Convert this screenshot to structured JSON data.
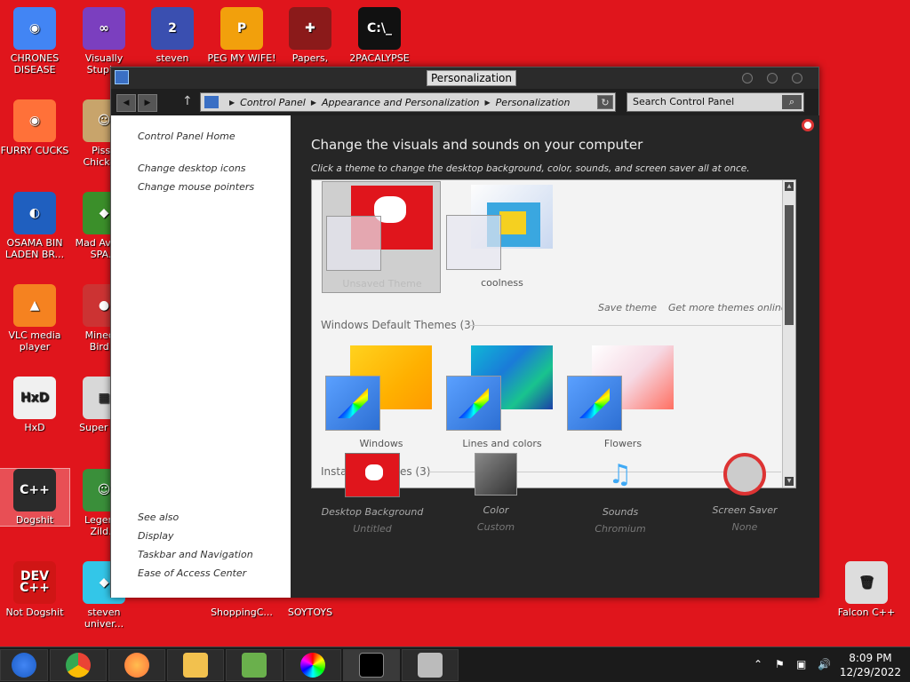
{
  "desktop": {
    "icons": [
      {
        "label": "CHRONES DISEASE",
        "glyph": "◉",
        "color": "#4285f4",
        "icon": "chrome-icon"
      },
      {
        "label": "Visually Stupi...",
        "glyph": "∞",
        "color": "#7b3fbf",
        "icon": "visual-studio-icon"
      },
      {
        "label": "steven",
        "glyph": "2",
        "color": "#3a4fb0",
        "icon": "app-icon"
      },
      {
        "label": "PEG MY WIFE!",
        "glyph": "P",
        "color": "#f2a00c",
        "icon": "app-icon"
      },
      {
        "label": "Papers,",
        "glyph": "✚",
        "color": "#8b1a1a",
        "icon": "app-icon"
      },
      {
        "label": "2PACALYPSE",
        "glyph": "C:\\_",
        "color": "#111111",
        "icon": "cmd-icon"
      },
      {
        "label": "FURRY CUCKS",
        "glyph": "◉",
        "color": "#ff7139",
        "icon": "firefox-icon"
      },
      {
        "label": "Pisse Chicke...",
        "glyph": "☺",
        "color": "#c8a46b",
        "icon": "app-icon"
      },
      {
        "label": "OSAMA BIN LADEN BR...",
        "glyph": "◐",
        "color": "#1f5fbf",
        "icon": "app-icon"
      },
      {
        "label": "Mad Av... IN SPA...",
        "glyph": "◆",
        "color": "#3b8f2a",
        "icon": "app-icon"
      },
      {
        "label": "VLC media player",
        "glyph": "▲",
        "color": "#f58220",
        "icon": "vlc-icon"
      },
      {
        "label": "Minec... Bird...",
        "glyph": "●",
        "color": "#cc3333",
        "icon": "app-icon"
      },
      {
        "label": "HxD",
        "glyph": "HxD",
        "color": "#f0f0f0",
        "icon": "hxd-icon"
      },
      {
        "label": "Super M...",
        "glyph": "▦",
        "color": "#d8d8d8",
        "icon": "app-icon"
      },
      {
        "label": "Dogshit",
        "glyph": "C++",
        "color": "#2b2b2b",
        "icon": "app-icon"
      },
      {
        "label": "Legen... Zild...",
        "glyph": "☺",
        "color": "#3a8f3a",
        "icon": "app-icon"
      },
      {
        "label": "Not Dogshit",
        "glyph": "DEV C++",
        "color": "#d01515",
        "icon": "devcpp-icon"
      },
      {
        "label": "steven univer...",
        "glyph": "◆",
        "color": "#33c6e8",
        "icon": "app-icon"
      },
      {
        "label": "ShoppingC...",
        "glyph": "",
        "color": "#e0151c",
        "icon": "app-icon"
      },
      {
        "label": "SOYTOYS",
        "glyph": "",
        "color": "#e0151c",
        "icon": "app-icon"
      },
      {
        "label": "Falcon C++",
        "glyph": "🗑",
        "color": "#dddddd",
        "icon": "recycle-bin-icon"
      }
    ]
  },
  "window": {
    "title": "Personalization",
    "address": {
      "crumbs": [
        "Control Panel",
        "Appearance and Personalization",
        "Personalization"
      ]
    },
    "search_placeholder": "Search Control Panel",
    "left": {
      "links": [
        "Control Panel Home",
        "Change desktop icons",
        "Change mouse pointers"
      ],
      "see_also_title": "See also",
      "see_also": [
        "Display",
        "Taskbar and Navigation",
        "Ease of Access Center"
      ]
    },
    "heading": "Change the visuals and sounds on your computer",
    "subheading": "Click a theme to change the desktop background, color, sounds, and screen saver all at once.",
    "my_themes": [
      {
        "name": "Unsaved Theme"
      },
      {
        "name": "coolness"
      }
    ],
    "save_theme": "Save theme",
    "get_more": "Get more themes online",
    "default_section": "Windows Default Themes (3)",
    "default_themes": [
      {
        "name": "Windows"
      },
      {
        "name": "Lines and colors"
      },
      {
        "name": "Flowers"
      }
    ],
    "installed_section": "Installed Themes (3)",
    "bottom": [
      {
        "label": "Desktop Background",
        "value": "Untitled"
      },
      {
        "label": "Color",
        "value": "Custom"
      },
      {
        "label": "Sounds",
        "value": "Chromium"
      },
      {
        "label": "Screen Saver",
        "value": "None"
      }
    ]
  },
  "taskbar": {
    "time": "8:09 PM",
    "date": "12/29/2022"
  }
}
